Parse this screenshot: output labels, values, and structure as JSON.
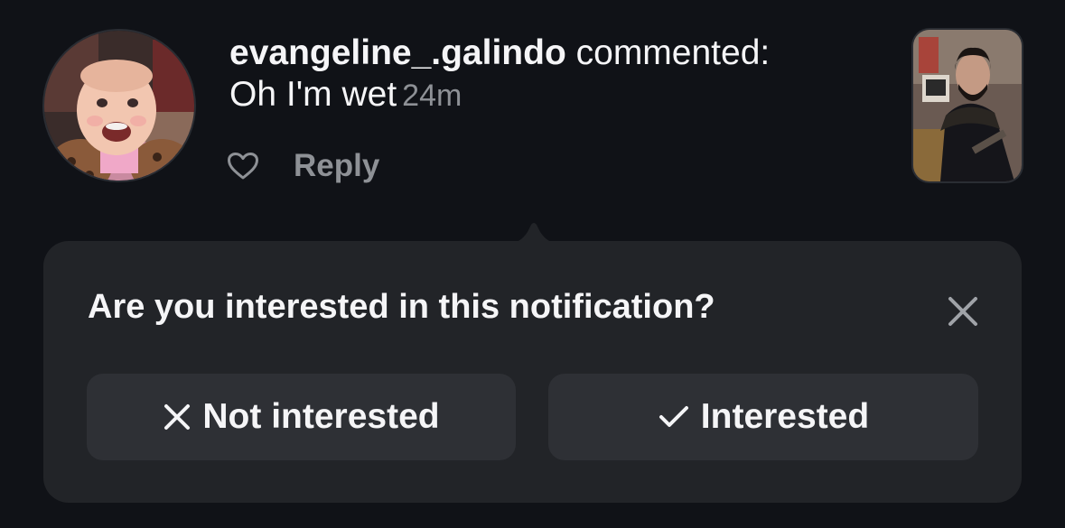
{
  "notification": {
    "username": "evangeline_.galindo",
    "action": "commented:",
    "comment": "Oh I'm wet",
    "time": "24m",
    "reply_label": "Reply",
    "avatar_icon": "profile-photo-avatar",
    "like_icon": "heart-outline-icon",
    "thumbnail_icon": "post-thumbnail"
  },
  "feedback": {
    "question": "Are you interested in this notification?",
    "close_icon": "close-icon",
    "not_interested": {
      "icon": "x-icon",
      "label": "Not interested"
    },
    "interested": {
      "icon": "checkmark-icon",
      "label": "Interested"
    }
  },
  "colors": {
    "background": "#101217",
    "popover": "#222428",
    "button": "#2e3035",
    "text_primary": "#f5f5f7",
    "text_secondary": "#8e9196"
  }
}
